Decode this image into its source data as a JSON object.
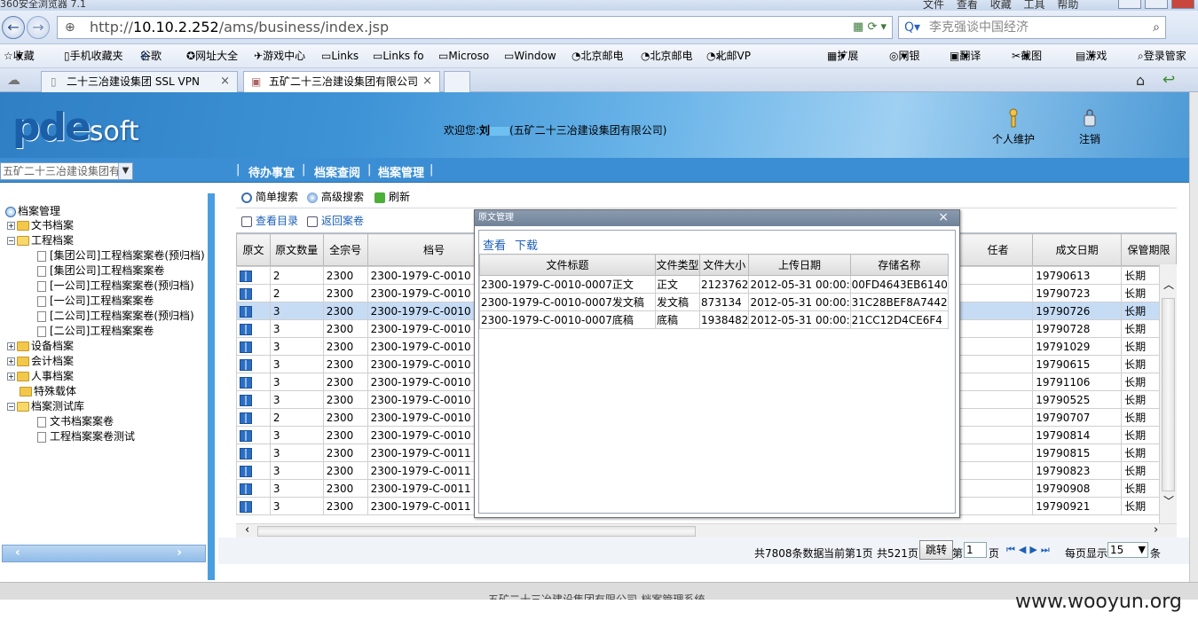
{
  "browser": {
    "window_title": "360安全浏览器 7.1",
    "menu_items": [
      "文件",
      "查看",
      "收藏",
      "工具",
      "帮助"
    ],
    "url_scheme": "http://",
    "url_host": "10.10.2.252",
    "url_path": "/ams/business/index.jsp",
    "search_text": "李克强谈中国经济",
    "bookmarks": [
      "收藏",
      "手机收藏夹",
      "谷歌",
      "网址大全",
      "游戏中心",
      "Links",
      "Links fo",
      "Microso",
      "Window",
      "北京邮电",
      "北京邮电",
      "北邮VP",
      "»",
      "扩展",
      "网银",
      "翻译",
      "截图",
      "游戏",
      "登录管家"
    ],
    "tabs": [
      {
        "label": "二十三冶建设集团 SSL VPN",
        "close": "×"
      },
      {
        "label": "五矿二十三冶建设集团有限公司",
        "close": "×"
      }
    ]
  },
  "header": {
    "logo_main": "pde",
    "logo_soft": "soft",
    "welcome_prefix": "欢迎您:",
    "welcome_user": "刘",
    "welcome_org": "(五矿二十三冶建设集团有限公司)",
    "btn_profile": "个人维护",
    "btn_logout": "注销"
  },
  "nav": {
    "org_select": "五矿二十三冶建设集团有",
    "items": [
      "待办事宜",
      "档案查阅",
      "档案管理"
    ]
  },
  "tree": {
    "root": "档案管理",
    "nodes": [
      "文书档案",
      "工程档案",
      "[集团公司]工程档案案卷(预归档)",
      "[集团公司]工程档案案卷",
      "[一公司]工程档案案卷(预归档)",
      "[一公司]工程档案案卷",
      "[二公司]工程档案案卷(预归档)",
      "[二公司]工程档案案卷",
      "设备档案",
      "会计档案",
      "人事档案",
      "特殊载体",
      "档案测试库",
      "文书档案案卷",
      "工程档案案卷测试"
    ]
  },
  "toolbar": {
    "simple_search": "简单搜索",
    "advanced_search": "高级搜索",
    "refresh": "刷新",
    "view_catalog": "查看目录",
    "back_volume": "返回案卷"
  },
  "grid": {
    "columns": [
      "原文",
      "原文数量",
      "全宗号",
      "档号",
      "任者",
      "成文日期",
      "保管期限"
    ],
    "rows": [
      {
        "count": "2",
        "fonds": "2300",
        "archive": "2300-1979-C-0010",
        "date": "19790613",
        "term": "长期"
      },
      {
        "count": "2",
        "fonds": "2300",
        "archive": "2300-1979-C-0010",
        "date": "19790723",
        "term": "长期"
      },
      {
        "count": "3",
        "fonds": "2300",
        "archive": "2300-1979-C-0010",
        "date": "19790726",
        "term": "长期"
      },
      {
        "count": "3",
        "fonds": "2300",
        "archive": "2300-1979-C-0010",
        "date": "19790728",
        "term": "长期"
      },
      {
        "count": "3",
        "fonds": "2300",
        "archive": "2300-1979-C-0010",
        "date": "19791029",
        "term": "长期"
      },
      {
        "count": "3",
        "fonds": "2300",
        "archive": "2300-1979-C-0010",
        "date": "19790615",
        "term": "长期"
      },
      {
        "count": "3",
        "fonds": "2300",
        "archive": "2300-1979-C-0010",
        "date": "19791106",
        "term": "长期"
      },
      {
        "count": "3",
        "fonds": "2300",
        "archive": "2300-1979-C-0010",
        "date": "19790525",
        "term": "长期"
      },
      {
        "count": "2",
        "fonds": "2300",
        "archive": "2300-1979-C-0010",
        "date": "19790707",
        "term": "长期"
      },
      {
        "count": "3",
        "fonds": "2300",
        "archive": "2300-1979-C-0010",
        "date": "19790814",
        "term": "长期"
      },
      {
        "count": "3",
        "fonds": "2300",
        "archive": "2300-1979-C-0011",
        "date": "19790815",
        "term": "长期"
      },
      {
        "count": "3",
        "fonds": "2300",
        "archive": "2300-1979-C-0011",
        "date": "19790823",
        "term": "长期"
      },
      {
        "count": "3",
        "fonds": "2300",
        "archive": "2300-1979-C-0011",
        "date": "19790908",
        "term": "长期"
      },
      {
        "count": "3",
        "fonds": "2300",
        "archive": "2300-1979-C-0011",
        "date": "19790921",
        "term": "长期"
      }
    ]
  },
  "pager": {
    "total": "共7808条数据",
    "current": "当前第1页",
    "pages": "共521页",
    "jump": "跳转",
    "page_prefix": "第",
    "page_value": "1",
    "page_suffix": "页",
    "per_page_prefix": "每页显示",
    "per_page_value": "15",
    "per_page_suffix": "条"
  },
  "dialog": {
    "title": "原文管理",
    "close": "×",
    "view": "查看",
    "download": "下载",
    "columns": [
      "文件标题",
      "文件类型",
      "文件大小",
      "上传日期",
      "存储名称"
    ],
    "rows": [
      {
        "title": "2300-1979-C-0010-0007正文",
        "type": "正文",
        "size": "2123762",
        "date": "2012-05-31 00:00:",
        "store": "00FD4643EB6140"
      },
      {
        "title": "2300-1979-C-0010-0007发文稿",
        "type": "发文稿",
        "size": "873134",
        "date": "2012-05-31 00:00:",
        "store": "31C28BEF8A7442"
      },
      {
        "title": "2300-1979-C-0010-0007底稿",
        "type": "底稿",
        "size": "1938482",
        "date": "2012-05-31 00:00:",
        "store": "21CC12D4CE6F4"
      }
    ]
  },
  "footer": {
    "text": "五矿二十三冶建设集团有限公司-档案管理系统"
  },
  "watermark": "www.wooyun.org"
}
